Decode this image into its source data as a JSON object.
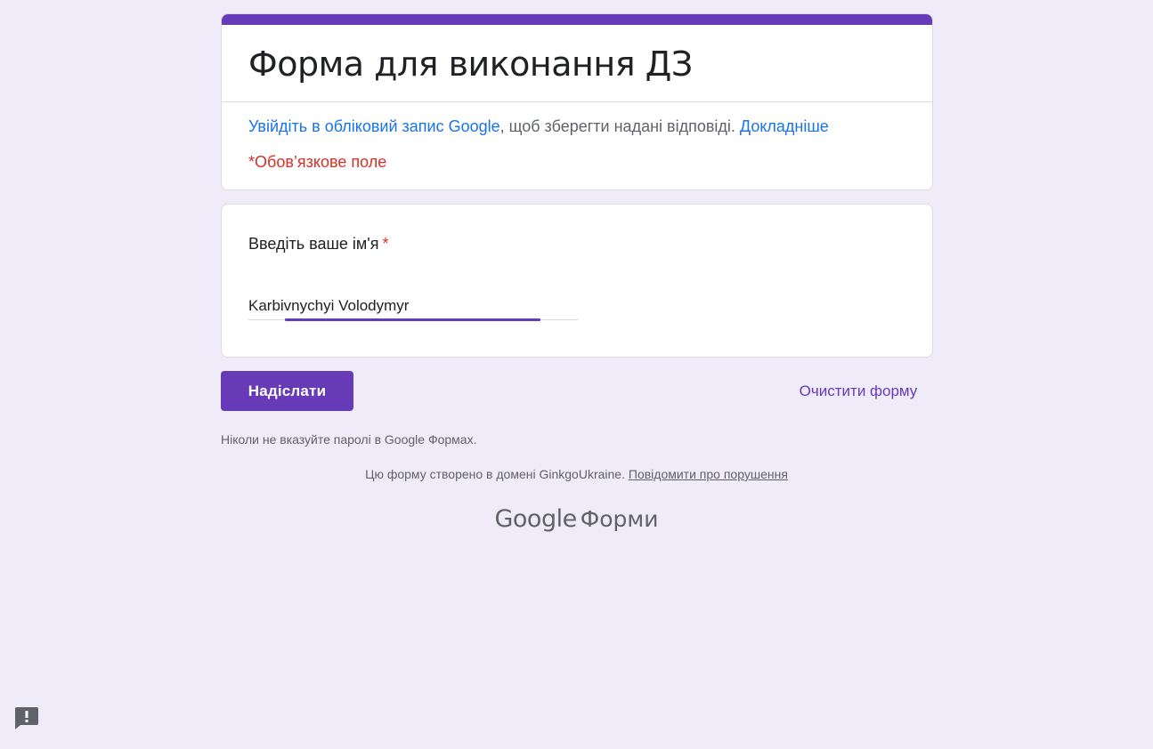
{
  "form": {
    "title": "Форма для виконання ДЗ",
    "signin": {
      "link_text": "Увійдіть в обліковий запис Google",
      "middle_text": ", щоб зберегти надані відповіді.",
      "learn_more": "Докладніше"
    },
    "required_note": "*Обов’язкове поле"
  },
  "question": {
    "label": "Введіть ваше ім'я",
    "required_mark": "*",
    "answer_value": "Karbivnychyi Volodymyr"
  },
  "actions": {
    "submit_label": "Надіслати",
    "clear_label": "Очистити форму"
  },
  "footer": {
    "password_warning": "Ніколи не вказуйте паролі в Google Формах.",
    "domain_text": "Цю форму створено в домені GinkgoUkraine.",
    "report_link": "Повідомити про порушення",
    "logo_google": "Google",
    "logo_product": "Форми"
  },
  "colors": {
    "accent": "#673ab7",
    "background": "#f0ebf8",
    "link": "#1a73e8",
    "required": "#d93025"
  },
  "icons": {
    "report": "report-problem-icon"
  }
}
